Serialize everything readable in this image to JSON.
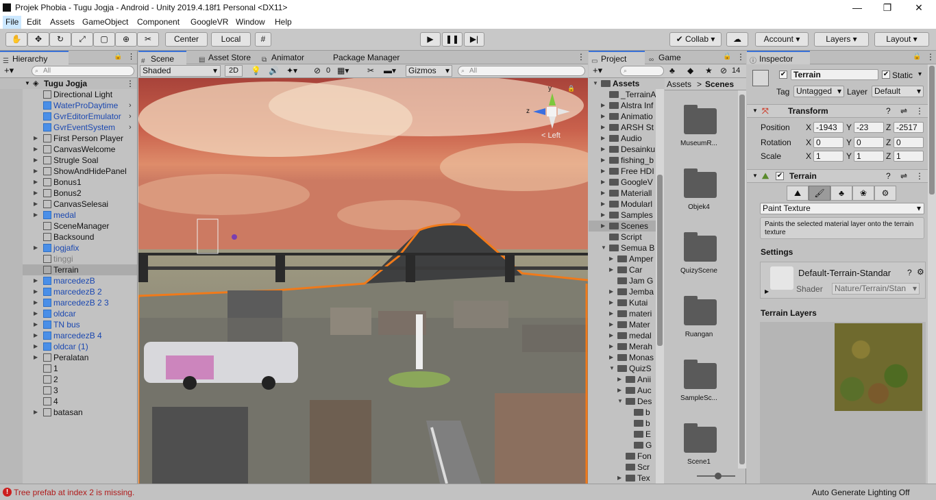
{
  "window": {
    "title": "Projek Phobia - Tugu Jogja - Android - Unity 2019.4.18f1 Personal <DX11>",
    "minimize": "—",
    "maximize": "❐",
    "close": "✕"
  },
  "menu": [
    "File",
    "Edit",
    "Assets",
    "GameObject",
    "Component",
    "GoogleVR",
    "Window",
    "Help"
  ],
  "toolbar": {
    "pivot": "Center",
    "space": "Local",
    "collab": "Collab",
    "account": "Account",
    "layers": "Layers",
    "layout": "Layout"
  },
  "hierarchy": {
    "tab": "Hierarchy",
    "search_placeholder": "All",
    "scene_name": "Tugu Jogja",
    "items": [
      {
        "label": "Directional Light",
        "style": "normal",
        "fold": "",
        "prefab": false,
        "arrow": false
      },
      {
        "label": "WaterProDaytime",
        "style": "blue",
        "fold": "",
        "prefab": true,
        "arrow": true
      },
      {
        "label": "GvrEditorEmulator",
        "style": "blue",
        "fold": "",
        "prefab": true,
        "arrow": true
      },
      {
        "label": "GvrEventSystem",
        "style": "blue",
        "fold": "",
        "prefab": true,
        "arrow": true
      },
      {
        "label": "First Person Player",
        "style": "normal",
        "fold": "▶",
        "prefab": false,
        "arrow": false
      },
      {
        "label": "CanvasWelcome",
        "style": "normal",
        "fold": "▶",
        "prefab": false,
        "arrow": false
      },
      {
        "label": "Strugle Soal",
        "style": "normal",
        "fold": "▶",
        "prefab": false,
        "arrow": false
      },
      {
        "label": "ShowAndHidePanel",
        "style": "normal",
        "fold": "▶",
        "prefab": false,
        "arrow": false
      },
      {
        "label": "Bonus1",
        "style": "normal",
        "fold": "▶",
        "prefab": false,
        "arrow": false
      },
      {
        "label": "Bonus2",
        "style": "normal",
        "fold": "▶",
        "prefab": false,
        "arrow": false
      },
      {
        "label": "CanvasSelesai",
        "style": "normal",
        "fold": "▶",
        "prefab": false,
        "arrow": false
      },
      {
        "label": "medal",
        "style": "blue",
        "fold": "▶",
        "prefab": true,
        "arrow": false
      },
      {
        "label": "SceneManager",
        "style": "normal",
        "fold": "",
        "prefab": false,
        "arrow": false
      },
      {
        "label": "Backsound",
        "style": "normal",
        "fold": "",
        "prefab": false,
        "arrow": false
      },
      {
        "label": "jogjafix",
        "style": "blue",
        "fold": "▶",
        "prefab": true,
        "arrow": false
      },
      {
        "label": "tinggi",
        "style": "gray",
        "fold": "",
        "prefab": false,
        "arrow": false
      },
      {
        "label": "Terrain",
        "style": "selected",
        "fold": "",
        "prefab": false,
        "arrow": false
      },
      {
        "label": "marcedezB",
        "style": "blue",
        "fold": "▶",
        "prefab": true,
        "arrow": false
      },
      {
        "label": "marcedezB 2",
        "style": "blue",
        "fold": "▶",
        "prefab": true,
        "arrow": false
      },
      {
        "label": "marcedezB 2 3",
        "style": "blue",
        "fold": "▶",
        "prefab": true,
        "arrow": false
      },
      {
        "label": "oldcar",
        "style": "blue",
        "fold": "▶",
        "prefab": true,
        "arrow": false
      },
      {
        "label": "TN bus",
        "style": "blue",
        "fold": "▶",
        "prefab": true,
        "arrow": false
      },
      {
        "label": "marcedezB 4",
        "style": "blue",
        "fold": "▶",
        "prefab": true,
        "arrow": false
      },
      {
        "label": "oldcar (1)",
        "style": "blue",
        "fold": "▶",
        "prefab": true,
        "arrow": false
      },
      {
        "label": "Peralatan",
        "style": "normal",
        "fold": "▶",
        "prefab": false,
        "arrow": false
      },
      {
        "label": "1",
        "style": "normal",
        "fold": "",
        "prefab": false,
        "arrow": false
      },
      {
        "label": "2",
        "style": "normal",
        "fold": "",
        "prefab": false,
        "arrow": false
      },
      {
        "label": "3",
        "style": "normal",
        "fold": "",
        "prefab": false,
        "arrow": false
      },
      {
        "label": "4",
        "style": "normal",
        "fold": "",
        "prefab": false,
        "arrow": false
      },
      {
        "label": "batasan",
        "style": "normal",
        "fold": "▶",
        "prefab": false,
        "arrow": false
      }
    ]
  },
  "scene": {
    "tabs": [
      "Scene",
      "Asset Store",
      "Animator",
      "Package Manager"
    ],
    "shading": "Shaded",
    "mode_2d": "2D",
    "hidden_count": "0",
    "gizmos": "Gizmos",
    "search_placeholder": "All",
    "gizmo_view": "Left",
    "axis_y": "y",
    "axis_z": "z"
  },
  "project": {
    "tabs": [
      "Project",
      "Game"
    ],
    "hidden_count": "14",
    "tree": [
      {
        "label": "Assets",
        "bold": true,
        "fold": "▼",
        "indent": 0
      },
      {
        "label": "_TerrainA",
        "bold": false,
        "fold": "",
        "indent": 1
      },
      {
        "label": "Alstra Inf",
        "bold": false,
        "fold": "▶",
        "indent": 1
      },
      {
        "label": "Animatio",
        "bold": false,
        "fold": "▶",
        "indent": 1
      },
      {
        "label": "ARSH St",
        "bold": false,
        "fold": "▶",
        "indent": 1
      },
      {
        "label": "Audio",
        "bold": false,
        "fold": "▶",
        "indent": 1
      },
      {
        "label": "Desainku",
        "bold": false,
        "fold": "▶",
        "indent": 1
      },
      {
        "label": "fishing_b",
        "bold": false,
        "fold": "▶",
        "indent": 1
      },
      {
        "label": "Free HDI",
        "bold": false,
        "fold": "▶",
        "indent": 1
      },
      {
        "label": "GoogleV",
        "bold": false,
        "fold": "▶",
        "indent": 1
      },
      {
        "label": "Materiall",
        "bold": false,
        "fold": "▶",
        "indent": 1
      },
      {
        "label": "Modularl",
        "bold": false,
        "fold": "▶",
        "indent": 1
      },
      {
        "label": "Samples",
        "bold": false,
        "fold": "▶",
        "indent": 1
      },
      {
        "label": "Scenes",
        "bold": false,
        "fold": "▶",
        "indent": 1,
        "selected": true
      },
      {
        "label": "Script",
        "bold": false,
        "fold": "",
        "indent": 1
      },
      {
        "label": "Semua B",
        "bold": false,
        "fold": "▼",
        "indent": 1
      },
      {
        "label": "Amper",
        "bold": false,
        "fold": "▶",
        "indent": 2
      },
      {
        "label": "Car",
        "bold": false,
        "fold": "▶",
        "indent": 2
      },
      {
        "label": "Jam G",
        "bold": false,
        "fold": "",
        "indent": 2
      },
      {
        "label": "Jemba",
        "bold": false,
        "fold": "▶",
        "indent": 2
      },
      {
        "label": "Kutai",
        "bold": false,
        "fold": "▶",
        "indent": 2
      },
      {
        "label": "materi",
        "bold": false,
        "fold": "▶",
        "indent": 2
      },
      {
        "label": "Mater",
        "bold": false,
        "fold": "▶",
        "indent": 2
      },
      {
        "label": "medal",
        "bold": false,
        "fold": "▶",
        "indent": 2
      },
      {
        "label": "Merah",
        "bold": false,
        "fold": "▶",
        "indent": 2
      },
      {
        "label": "Monas",
        "bold": false,
        "fold": "▶",
        "indent": 2
      },
      {
        "label": "QuizS",
        "bold": false,
        "fold": "▼",
        "indent": 2
      },
      {
        "label": "Anii",
        "bold": false,
        "fold": "▶",
        "indent": 3
      },
      {
        "label": "Auc",
        "bold": false,
        "fold": "▶",
        "indent": 3
      },
      {
        "label": "Des",
        "bold": false,
        "fold": "▼",
        "indent": 3
      },
      {
        "label": "b",
        "bold": false,
        "fold": "",
        "indent": 4
      },
      {
        "label": "b",
        "bold": false,
        "fold": "",
        "indent": 4
      },
      {
        "label": "E",
        "bold": false,
        "fold": "",
        "indent": 4
      },
      {
        "label": "G",
        "bold": false,
        "fold": "",
        "indent": 4
      },
      {
        "label": "Fon",
        "bold": false,
        "fold": "",
        "indent": 3
      },
      {
        "label": "Scr",
        "bold": false,
        "fold": "",
        "indent": 3
      },
      {
        "label": "Tex",
        "bold": false,
        "fold": "▶",
        "indent": 3
      }
    ],
    "breadcrumb": [
      "Assets",
      "Scenes"
    ],
    "folders": [
      "MuseumR...",
      "Objek4",
      "QuizyScene",
      "Ruangan",
      "SampleSc...",
      "Scene1"
    ]
  },
  "inspector": {
    "tab": "Inspector",
    "object_name": "Terrain",
    "static_label": "Static",
    "tag_label": "Tag",
    "tag_value": "Untagged",
    "layer_label": "Layer",
    "layer_value": "Default",
    "transform": {
      "title": "Transform",
      "position_label": "Position",
      "rotation_label": "Rotation",
      "scale_label": "Scale",
      "position": [
        "-1943",
        "-23",
        "-2517"
      ],
      "rotation": [
        "0",
        "0",
        "0"
      ],
      "scale": [
        "1",
        "1",
        "1"
      ],
      "axes": [
        "X",
        "Y",
        "Z"
      ]
    },
    "terrain": {
      "title": "Terrain",
      "tool_dropdown": "Paint Texture",
      "help": "Paints the selected material layer onto the terrain texture",
      "settings_label": "Settings",
      "material_name": "Default-Terrain-Standar",
      "shader_label": "Shader",
      "shader_value": "Nature/Terrain/Stan",
      "layers_label": "Terrain Layers"
    }
  },
  "status": {
    "error": "Tree prefab at index 2 is missing.",
    "right": "Auto Generate Lighting Off"
  },
  "colors": {
    "accent": "#3a72d8",
    "selection": "#3e7de0",
    "terrain_outline": "#f07a1a",
    "prefab_blue": "#1a47b0",
    "error_red": "#cc1f1f"
  }
}
